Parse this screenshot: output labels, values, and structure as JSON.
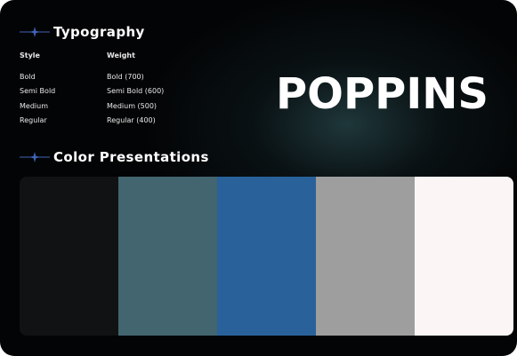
{
  "typography": {
    "heading": "Typography",
    "col_style": "Style",
    "col_weight": "Weight",
    "rows": [
      {
        "style": "Bold",
        "weight": "Bold (700)"
      },
      {
        "style": "Semi Bold",
        "weight": "Semi Bold (600)"
      },
      {
        "style": "Medium",
        "weight": "Medium (500)"
      },
      {
        "style": "Regular",
        "weight": "Regular (400)"
      }
    ],
    "font_name": "POPPINS"
  },
  "colors": {
    "heading": "Color Presentations",
    "swatches": [
      "#111214",
      "#43656f",
      "#29629a",
      "#9e9e9e",
      "#fbf6f5"
    ],
    "accent": "#3f63b8"
  },
  "icons": {
    "section_marker": "sparkle-line-icon"
  }
}
